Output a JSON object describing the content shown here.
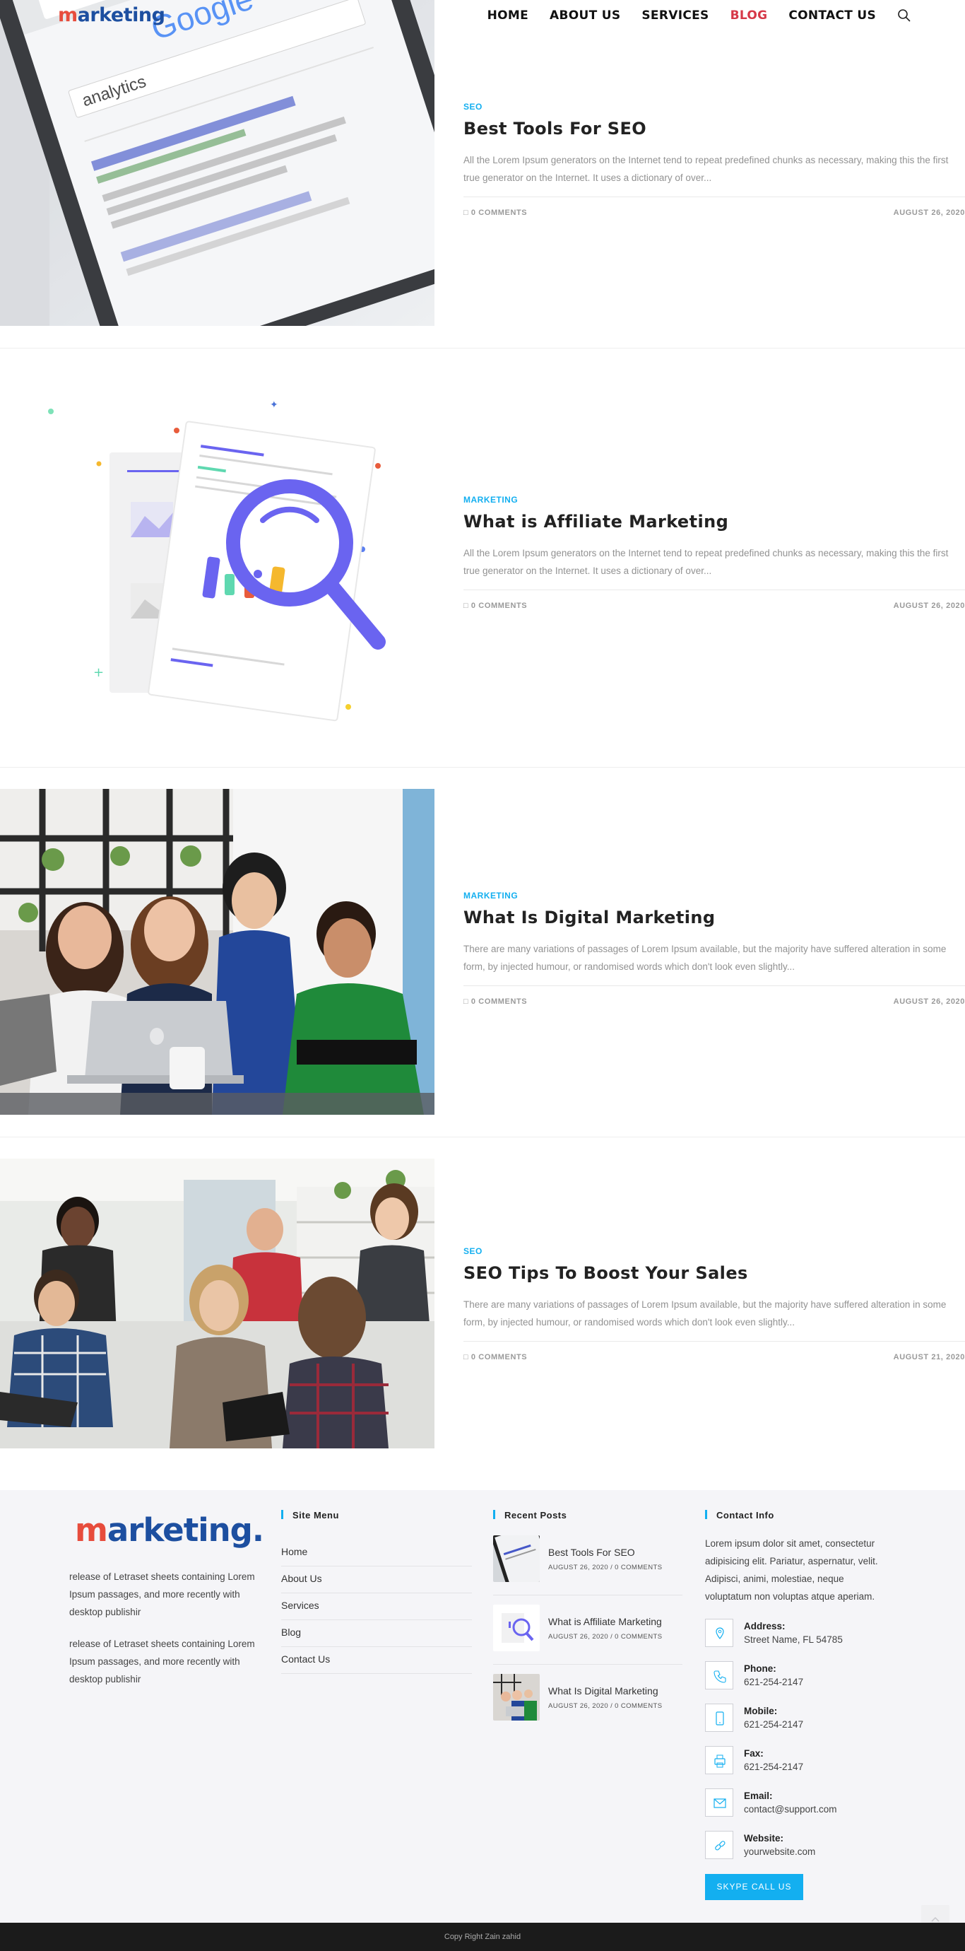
{
  "header": {
    "logo_initial": "m",
    "logo_rest": "arketing",
    "nav": [
      {
        "label": "HOME"
      },
      {
        "label": "ABOUT US"
      },
      {
        "label": "SERVICES"
      },
      {
        "label": "BLOG"
      },
      {
        "label": "CONTACT US"
      }
    ],
    "active_nav": "BLOG",
    "search_icon": "search-icon"
  },
  "posts": [
    {
      "category": "SEO",
      "title": "Best Tools For SEO",
      "excerpt": "All the Lorem Ipsum generators on the Internet tend to repeat predefined chunks as necessary, making this the first true generator on the Internet. It uses a dictionary of over...",
      "comments": "0 COMMENTS",
      "date": "AUGUST 26, 2020"
    },
    {
      "category": "MARKETING",
      "title": "What is Affiliate Marketing",
      "excerpt": "All the Lorem Ipsum generators on the Internet tend to repeat predefined chunks as necessary, making this the first true generator on the Internet. It uses a dictionary of over...",
      "comments": "0 COMMENTS",
      "date": "AUGUST 26, 2020"
    },
    {
      "category": "MARKETING",
      "title": "What Is Digital Marketing",
      "excerpt": "There are many variations of passages of Lorem Ipsum available, but the majority have suffered alteration in some form, by injected humour, or randomised words which don't look even slightly...",
      "comments": "0 COMMENTS",
      "date": "AUGUST 26, 2020"
    },
    {
      "category": "SEO",
      "title": "SEO Tips To Boost Your Sales",
      "excerpt": "There are many variations of passages of Lorem Ipsum available, but the majority have suffered alteration in some form, by injected humour, or randomised words which don't look even slightly...",
      "comments": "0 COMMENTS",
      "date": "AUGUST 21, 2020"
    }
  ],
  "post_images": {
    "phone_screen_search": "Google",
    "phone_screen_query": "analytics"
  },
  "footer": {
    "logo_initial": "m",
    "logo_rest": "arketing.",
    "about": [
      "release of Letraset sheets containing Lorem Ipsum passages, and more recently with desktop publishir",
      "release of Letraset sheets containing Lorem Ipsum passages, and more recently with desktop publishir"
    ],
    "site_menu_title": "Site Menu",
    "site_menu": [
      "Home",
      "About Us",
      "Services",
      "Blog",
      "Contact Us"
    ],
    "recent_posts_title": "Recent Posts",
    "recent_posts": [
      {
        "title": "Best Tools For SEO",
        "meta": "AUGUST 26, 2020 / 0 COMMENTS"
      },
      {
        "title": "What is Affiliate Marketing",
        "meta": "AUGUST 26, 2020 / 0 COMMENTS"
      },
      {
        "title": "What Is Digital Marketing",
        "meta": "AUGUST 26, 2020 / 0 COMMENTS"
      }
    ],
    "contact_title": "Contact Info",
    "contact_intro": "Lorem ipsum dolor sit amet, consectetur adipisicing elit. Pariatur, aspernatur, velit. Adipisci, animi, molestiae, neque voluptatum non voluptas atque aperiam.",
    "contacts": [
      {
        "label": "Address:",
        "value": "Street Name, FL 54785",
        "icon": "map-pin-icon"
      },
      {
        "label": "Phone:",
        "value": "621-254-2147",
        "icon": "phone-icon"
      },
      {
        "label": "Mobile:",
        "value": "621-254-2147",
        "icon": "mobile-icon"
      },
      {
        "label": "Fax:",
        "value": "621-254-2147",
        "icon": "fax-icon"
      },
      {
        "label": "Email:",
        "value": "contact@support.com",
        "icon": "envelope-icon"
      },
      {
        "label": "Website:",
        "value": "yourwebsite.com",
        "icon": "link-icon"
      }
    ],
    "skype_label": "SKYPE CALL US",
    "copyright": "Copy Right Zain zahid"
  },
  "colors": {
    "accent": "#13aff0",
    "brand_blue": "#1d4fa0",
    "brand_red": "#e74c3c",
    "active_nav": "#d63848"
  }
}
